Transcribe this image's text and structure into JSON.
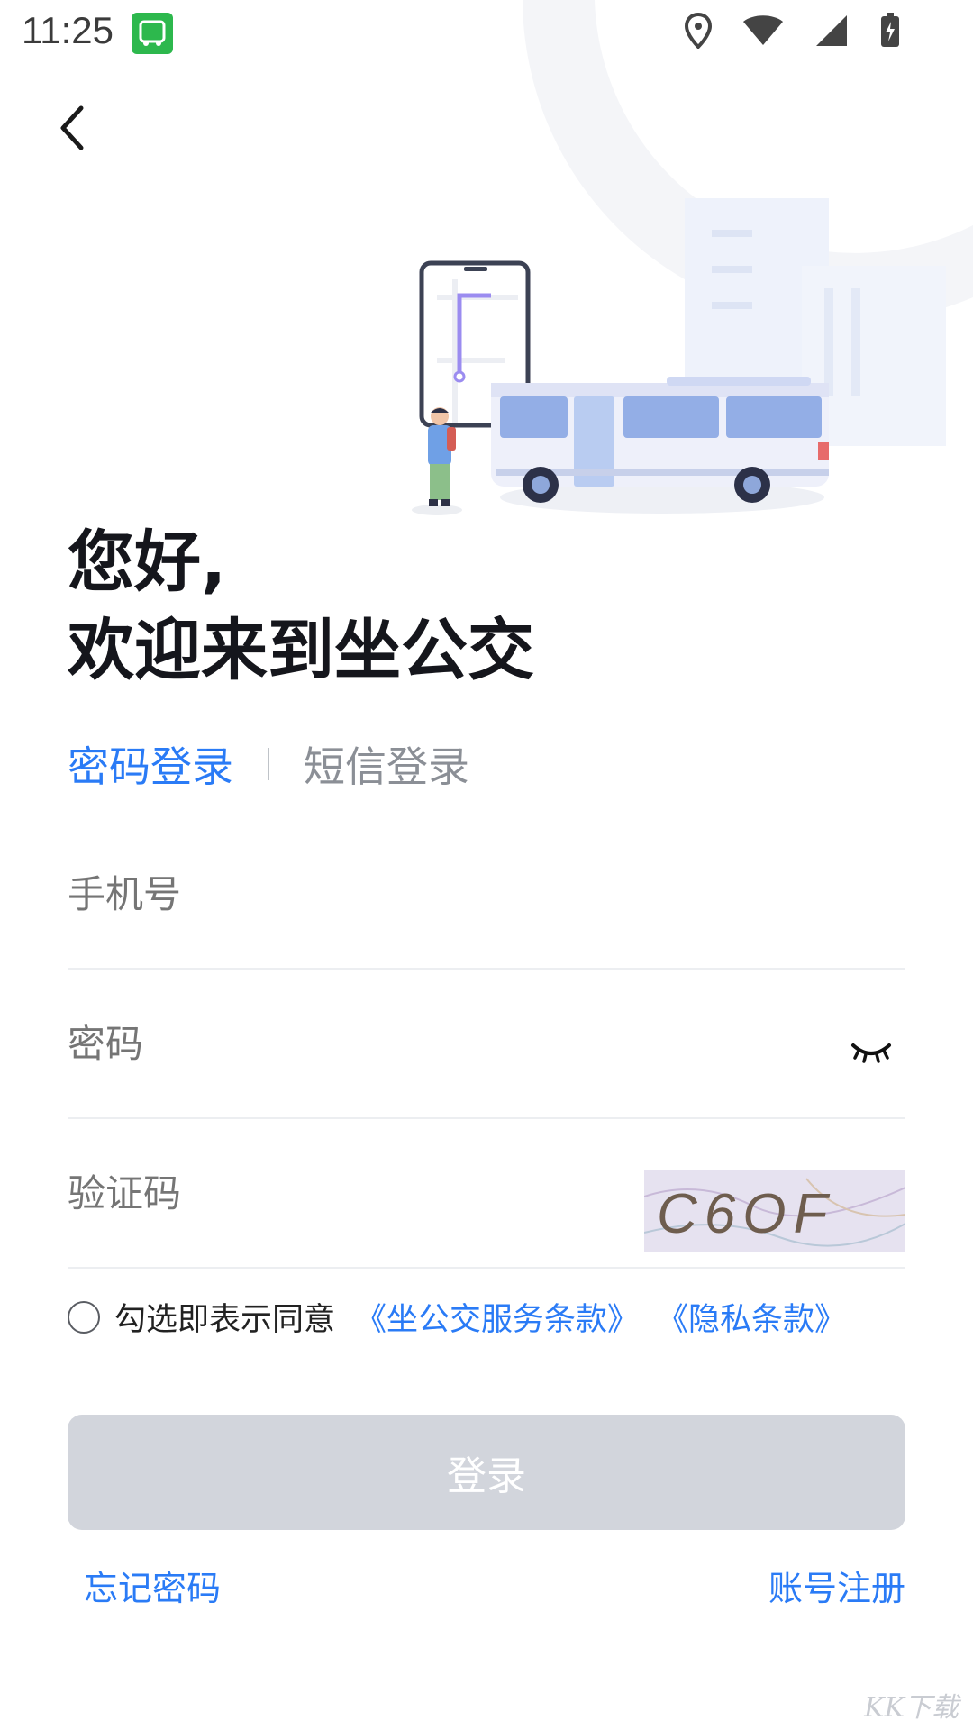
{
  "status_bar": {
    "time": "11:25"
  },
  "greeting": {
    "line1": "您好,",
    "line2": "欢迎来到坐公交"
  },
  "tabs": [
    {
      "label": "密码登录"
    },
    {
      "label": "短信登录"
    }
  ],
  "fields": {
    "phone_placeholder": "手机号",
    "password_placeholder": "密码",
    "captcha_placeholder": "验证码",
    "captcha_code": "C6OF"
  },
  "agreement": {
    "text": "勾选即表示同意",
    "terms_link": "《坐公交服务条款》",
    "privacy_link": "《隐私条款》"
  },
  "login_button": "登录",
  "links": {
    "forgot": "忘记密码",
    "register": "账号注册"
  },
  "watermark": "KK下载",
  "colors": {
    "accent": "#2a7bf6",
    "button_disabled": "#d2d5dc"
  }
}
